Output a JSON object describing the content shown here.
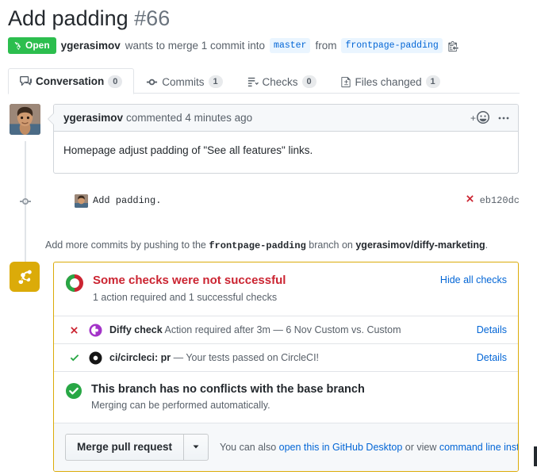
{
  "pr": {
    "title": "Add padding",
    "number": "#66",
    "state": "Open",
    "author": "ygerasimov",
    "meta_text_1": "wants to merge 1 commit into",
    "base_branch": "master",
    "meta_text_2": "from",
    "head_branch": "frontpage-padding"
  },
  "tabs": [
    {
      "label": "Conversation",
      "count": "0",
      "icon": "comment-discussion-icon",
      "active": true
    },
    {
      "label": "Commits",
      "count": "1",
      "icon": "git-commit-icon",
      "active": false
    },
    {
      "label": "Checks",
      "count": "0",
      "icon": "checklist-icon",
      "active": false
    },
    {
      "label": "Files changed",
      "count": "1",
      "icon": "file-diff-icon",
      "active": false
    }
  ],
  "comment": {
    "author": "ygerasimov",
    "action": "commented 4 minutes ago",
    "body": "Homepage adjust padding of \"See all features\" links."
  },
  "commit": {
    "message": "Add padding.",
    "sha": "eb120dc",
    "status": "failed"
  },
  "commits_note": {
    "prefix": "Add more commits by pushing to the",
    "branch": "frontpage-padding",
    "middle": "branch on",
    "repo": "ygerasimov/diffy-marketing",
    "suffix": "."
  },
  "checks": {
    "title": "Some checks were not successful",
    "subtitle": "1 action required and 1 successful checks",
    "hide_link": "Hide all checks",
    "rows": [
      {
        "status": "failure",
        "logo": "diffy-icon",
        "name": "Diffy check",
        "description": "Action required after 3m — 6 Nov Custom vs. Custom",
        "details": "Details"
      },
      {
        "status": "success",
        "logo": "circleci-icon",
        "name": "ci/circleci: pr",
        "description": "— Your tests passed on CircleCI!",
        "details": "Details"
      }
    ]
  },
  "conflicts": {
    "title": "This branch has no conflicts with the base branch",
    "subtitle": "Merging can be performed automatically."
  },
  "merge": {
    "button_label": "Merge pull request",
    "note_prefix": "You can also",
    "link_desktop": "open this in GitHub Desktop",
    "note_middle": "or view",
    "link_cli": "command line instructions",
    "note_suffix": "."
  },
  "colors": {
    "open_green": "#2cbe4e",
    "danger_red": "#cb2431",
    "link_blue": "#0366d6",
    "warn_gold": "#dbab09",
    "muted": "#586069"
  }
}
